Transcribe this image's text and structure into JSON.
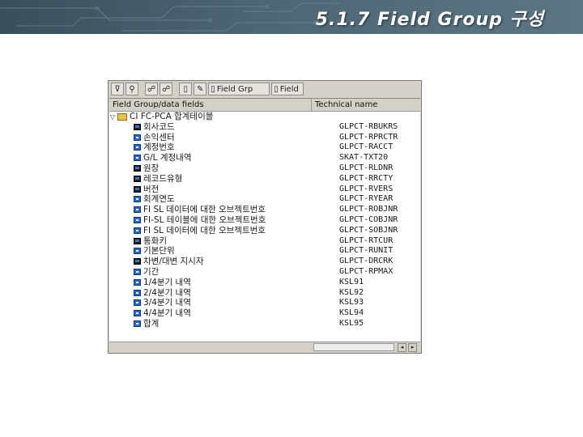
{
  "slide": {
    "title": "5.1.7 Field Group 구성"
  },
  "toolbar": {
    "buttons": [
      {
        "icon": "filter-icon"
      },
      {
        "icon": "find-icon"
      },
      {
        "icon": "binoculars-icon"
      },
      {
        "icon": "binoculars-next-icon"
      },
      {
        "icon": "new-document-icon"
      },
      {
        "icon": "pencil-icon"
      }
    ],
    "field_group_button": "Field Grp",
    "field_button": "Field"
  },
  "columns": {
    "name": "Field Group/data fields",
    "technical": "Technical name"
  },
  "tree": {
    "root": {
      "label": "CI FC-PCA 합계테이블"
    },
    "rows": [
      {
        "icon": "key",
        "name": "회사코드",
        "tech": "GLPCT-RBUKRS"
      },
      {
        "icon": "field",
        "name": "손익센터",
        "tech": "GLPCT-RPRCTR"
      },
      {
        "icon": "field",
        "name": "계정번호",
        "tech": "GLPCT-RACCT"
      },
      {
        "icon": "field",
        "name": "G/L 계정내역",
        "tech": "SKAT-TXT20"
      },
      {
        "icon": "key",
        "name": "원장",
        "tech": "GLPCT-RLDNR"
      },
      {
        "icon": "key",
        "name": "레코드유형",
        "tech": "GLPCT-RRCTY"
      },
      {
        "icon": "key",
        "name": "버전",
        "tech": "GLPCT-RVERS"
      },
      {
        "icon": "field",
        "name": "회계연도",
        "tech": "GLPCT-RYEAR"
      },
      {
        "icon": "field",
        "name": "FI SL 데이터에 대한 오브젝트번호",
        "tech": "GLPCT-ROBJNR"
      },
      {
        "icon": "field",
        "name": "FI-SL 테이블에 대한 오브젝트번호",
        "tech": "GLPCT-COBJNR"
      },
      {
        "icon": "field",
        "name": "FI SL 데이터에 대한 오브젝트번호",
        "tech": "GLPCT-SOBJNR"
      },
      {
        "icon": "key",
        "name": "통화키",
        "tech": "GLPCT-RTCUR"
      },
      {
        "icon": "field",
        "name": "기본단위",
        "tech": "GLPCT-RUNIT"
      },
      {
        "icon": "key",
        "name": "차변/대변 지시자",
        "tech": "GLPCT-DRCRK"
      },
      {
        "icon": "field",
        "name": "기간",
        "tech": "GLPCT-RPMAX"
      },
      {
        "icon": "field",
        "name": "1/4분기 내역",
        "tech": "KSL91"
      },
      {
        "icon": "field",
        "name": "2/4분기 내역",
        "tech": "KSL92"
      },
      {
        "icon": "field",
        "name": "3/4분기 내역",
        "tech": "KSL93"
      },
      {
        "icon": "field",
        "name": "4/4분기 내역",
        "tech": "KSL94"
      },
      {
        "icon": "field",
        "name": "합계",
        "tech": "KSL95"
      }
    ]
  }
}
